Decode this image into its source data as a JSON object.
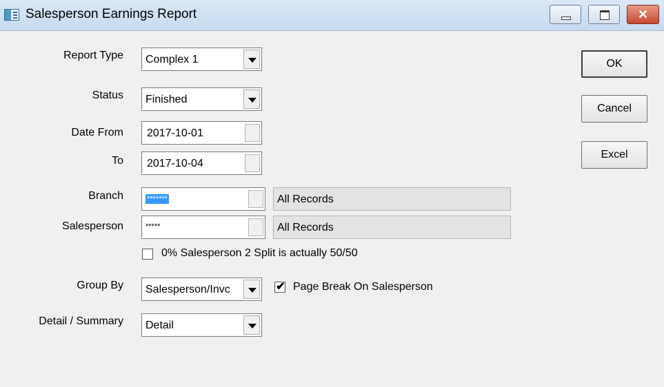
{
  "window": {
    "title": "Salesperson Earnings Report"
  },
  "form": {
    "report_type": {
      "label": "Report Type",
      "value": "Complex 1"
    },
    "status": {
      "label": "Status",
      "value": "Finished"
    },
    "date_from": {
      "label": "Date From",
      "value": "2017-10-01"
    },
    "date_to": {
      "label": "To",
      "value": "2017-10-04"
    },
    "branch": {
      "label": "Branch",
      "value": "*******",
      "display": "All Records"
    },
    "salesperson": {
      "label": "Salesperson",
      "value": "*****",
      "display": "All Records"
    },
    "split_checkbox": {
      "label": "0% Salesperson 2 Split is actually 50/50",
      "checked": false
    },
    "group_by": {
      "label": "Group By",
      "value": "Salesperson/Invc"
    },
    "page_break": {
      "label": "Page Break On Salesperson",
      "checked": true
    },
    "detail_summary": {
      "label": "Detail / Summary",
      "value": "Detail"
    }
  },
  "buttons": {
    "ok": "OK",
    "cancel": "Cancel",
    "excel": "Excel"
  },
  "glyphs": {
    "check": "✔",
    "close": "✕"
  }
}
